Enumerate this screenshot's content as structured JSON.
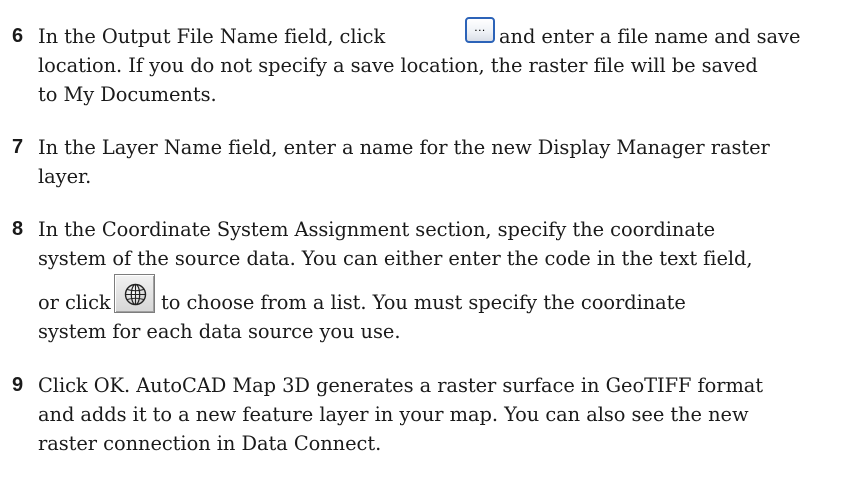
{
  "steps": [
    {
      "number": "6",
      "lines": [
        {
          "before": "In the Output File Name field, click",
          "after": "and enter a file name and save"
        },
        "location. If you do not specify a save location, the raster file will be saved",
        "to My Documents."
      ],
      "button": {
        "label": "...",
        "icon": "ellipsis-browse-icon"
      }
    },
    {
      "number": "7",
      "lines": [
        "In the Layer Name field, enter a name for the new Display Manager raster",
        "layer."
      ]
    },
    {
      "number": "8",
      "lines": [
        "In the Coordinate System Assignment section, specify the coordinate",
        "system of the source data. You can either enter the code in the text field,",
        {
          "before": "or click",
          "after": "to choose from a list. You must specify the coordinate"
        },
        "system for each data source you use."
      ],
      "button": {
        "icon": "globe-icon"
      }
    },
    {
      "number": "9",
      "lines": [
        "Click OK. AutoCAD Map 3D generates a raster surface in GeoTIFF format",
        "and adds it to a new feature layer in your map. You can also see the new",
        "raster connection in Data Connect."
      ]
    }
  ]
}
